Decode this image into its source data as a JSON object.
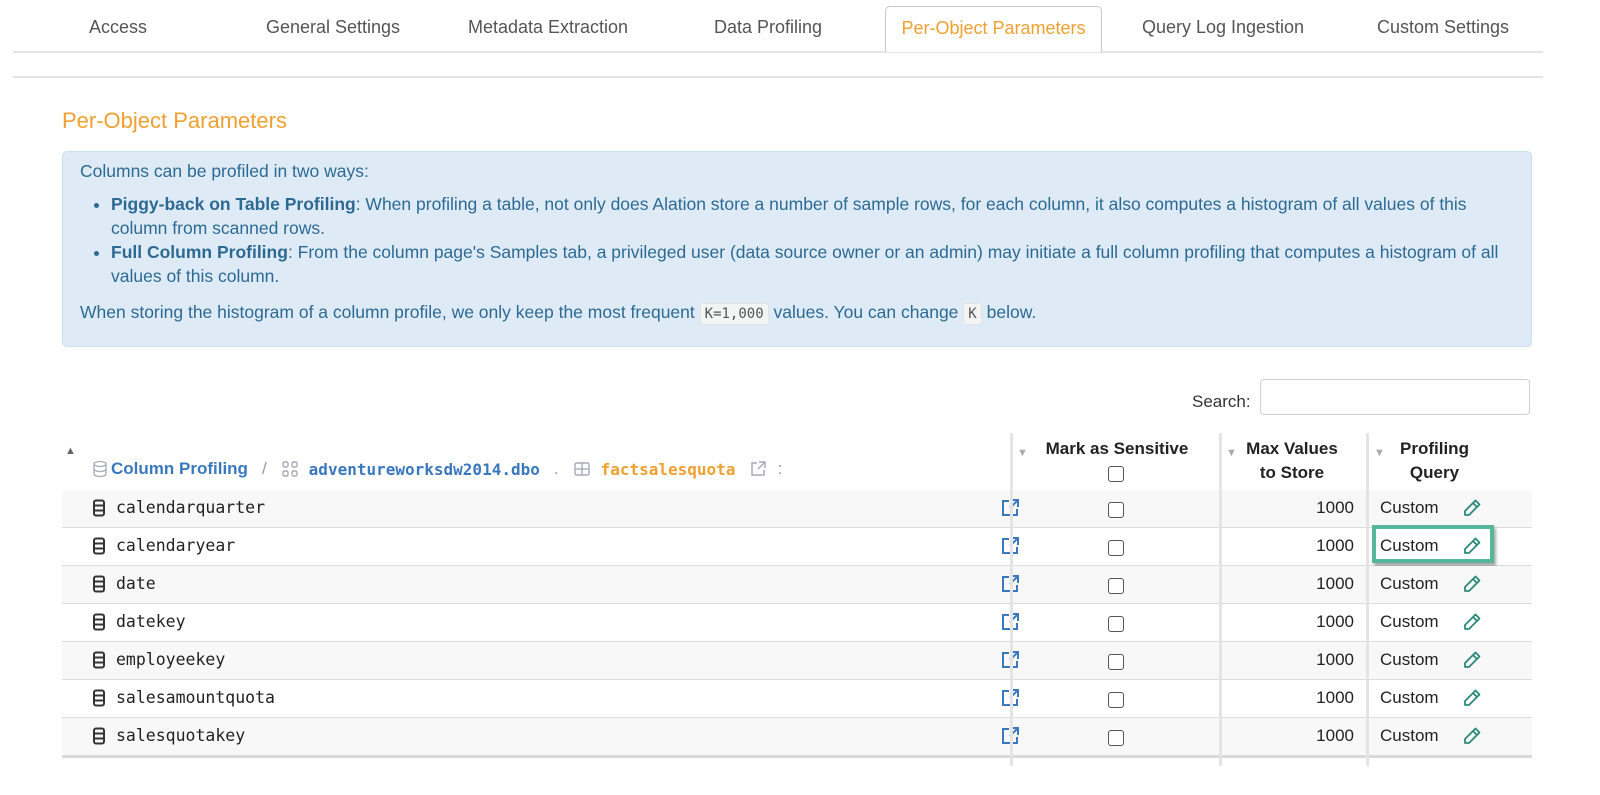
{
  "tabs": [
    {
      "label": "Access",
      "active": false
    },
    {
      "label": "General Settings",
      "active": false
    },
    {
      "label": "Metadata Extraction",
      "active": false
    },
    {
      "label": "Data Profiling",
      "active": false
    },
    {
      "label": "Per-Object Parameters",
      "active": true
    },
    {
      "label": "Query Log Ingestion",
      "active": false
    },
    {
      "label": "Custom Settings",
      "active": false
    }
  ],
  "page_title": "Per-Object Parameters",
  "info": {
    "intro": "Columns can be profiled in two ways:",
    "items": [
      {
        "title": "Piggy-back on Table Profiling",
        "text": ": When profiling a table, not only does Alation store a number of sample rows, for each column, it also computes a histogram of all values of this column from scanned rows."
      },
      {
        "title": "Full Column Profiling",
        "text": ": From the column page's Samples tab, a privileged user (data source owner or an admin) may initiate a full column profiling that computes a histogram of all values of this column."
      }
    ],
    "footer_pre": "When storing the histogram of a column profile, we only keep the most frequent",
    "footer_code1": "K=1,000",
    "footer_mid": "values. You can change",
    "footer_code2": "K",
    "footer_post": "below."
  },
  "search": {
    "label": "Search:",
    "value": "",
    "placeholder": ""
  },
  "table": {
    "breadcrumb": {
      "root": "Column Profiling",
      "slash": "/",
      "schema": "adventureworksdw2014.dbo",
      "dot": ".",
      "table": "factsalesquota",
      "colon": ":"
    },
    "headers": {
      "sensitive": "Mark as Sensitive",
      "max_values_1": "Max Values",
      "max_values_2": "to Store",
      "query_1": "Profiling",
      "query_2": "Query"
    },
    "rows": [
      {
        "name": "calendarquarter",
        "max_values": "1000",
        "query": "Custom",
        "sensitive": false
      },
      {
        "name": "calendaryear",
        "max_values": "1000",
        "query": "Custom",
        "sensitive": false,
        "highlighted": true
      },
      {
        "name": "date",
        "max_values": "1000",
        "query": "Custom",
        "sensitive": false
      },
      {
        "name": "datekey",
        "max_values": "1000",
        "query": "Custom",
        "sensitive": false
      },
      {
        "name": "employeekey",
        "max_values": "1000",
        "query": "Custom",
        "sensitive": false
      },
      {
        "name": "salesamountquota",
        "max_values": "1000",
        "query": "Custom",
        "sensitive": false
      },
      {
        "name": "salesquotakey",
        "max_values": "1000",
        "query": "Custom",
        "sensitive": false
      }
    ]
  },
  "colors": {
    "accent_orange": "#f0a030",
    "link_blue": "#3a78c0",
    "info_bg": "#deebf6",
    "info_text": "#2d6a93",
    "highlight_green": "#56b69b",
    "pencil_teal": "#2a8a78"
  }
}
